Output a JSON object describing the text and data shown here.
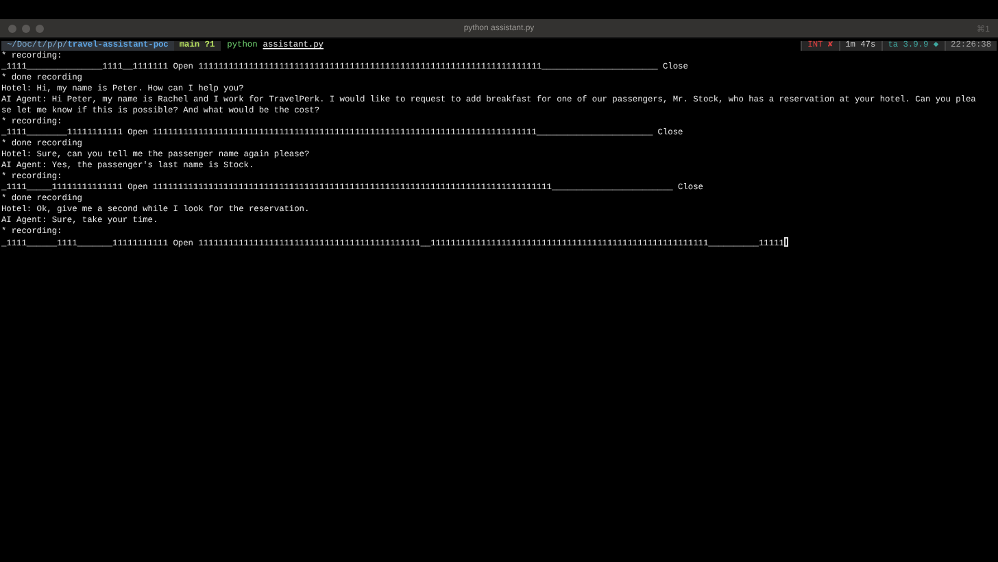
{
  "window": {
    "title": "python assistant.py",
    "shortcut": "⌘1"
  },
  "prompt": {
    "path": "~/Doc/t/p/p/",
    "directory": "travel-assistant-poc",
    "branch": "main ?1",
    "command": "python",
    "argument": "assistant.py"
  },
  "right_status": [
    {
      "kind": "error",
      "text": "INT ✘"
    },
    {
      "kind": "plain",
      "text": "1m 47s"
    },
    {
      "kind": "env",
      "text": "ta 3.9.9 ◆"
    },
    {
      "kind": "time",
      "text": "22:26:38"
    }
  ],
  "lines": [
    "* recording:",
    "_1111_______________1111__1111111 Open 11111111111111111111111111111111111111111111111111111111111111111111_______________________ Close",
    "* done recording",
    "Hotel: Hi, my name is Peter. How can I help you?",
    "AI Agent: Hi Peter, my name is Rachel and I work for TravelPerk. I would like to request to add breakfast for one of our passengers, Mr. Stock, who has a reservation at your hotel. Can you plea",
    "se let me know if this is possible? And what would be the cost?",
    "* recording:",
    "_1111________11111111111 Open 1111111111111111111111111111111111111111111111111111111111111111111111111111_______________________ Close",
    "* done recording",
    "Hotel: Sure, can you tell me the passenger name again please?",
    "AI Agent: Yes, the passenger's last name is Stock.",
    "* recording:",
    "_1111_____11111111111111 Open 1111111111111111111111111111111111111111111111111111111111111111111111111111111________________________ Close",
    "* done recording",
    "Hotel: Ok, give me a second while I look for the reservation.",
    "AI Agent: Sure, take your time.",
    "* recording:",
    "_1111______1111_______11111111111 Open 11111111111111111111111111111111111111111111__1111111111111111111111111111111111111111111111111111111__________11111"
  ],
  "cursor": true
}
